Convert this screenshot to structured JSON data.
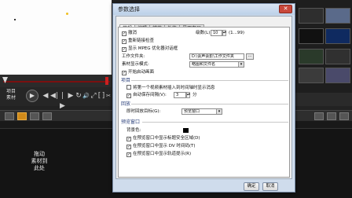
{
  "transport": {
    "project_label": "项目",
    "clip_label": "素材",
    "play_icon": "▶",
    "controls": [
      "◀",
      "◀|",
      "|▶",
      "▶",
      "↻",
      "🔊",
      "⤢",
      "[",
      "]",
      "✂"
    ]
  },
  "timeline": {
    "clip_note": "拖动\n素材到\n此处"
  },
  "dialog": {
    "title": "参数选择",
    "close_label": "✕",
    "tabs": [
      "常规",
      "编辑",
      "捕获",
      "性能",
      "界面布局"
    ],
    "active_tab": "常规",
    "options": {
      "undo_label": "撤消",
      "undo_levels_label": "级数(L):",
      "undo_levels_value": "10",
      "undo_range": "(1...99)",
      "relink_label": "重新链接检查",
      "mpeg_label": "显示 MPEG 优化器对话框",
      "workdir_label": "工作文件夹:",
      "workdir_value": "D:\\会声会影\\工作文件夹",
      "browse_label": "...",
      "media_display_label": "素材显示模式:",
      "media_display_value": "略图和文件名",
      "welcome_label": "开始启动画面"
    },
    "project_section": {
      "title": "项目",
      "insert_first_clip_label": "将第一个视频素材插入到时间轴时显示消息",
      "autosave_label": "自动保存间隔(V):",
      "autosave_value": "3",
      "autosave_unit": "分"
    },
    "playback_section": {
      "title": "回放",
      "target_label": "即时回放目标(G):",
      "target_value": "预览窗口"
    },
    "preview_section": {
      "title": "预览窗口",
      "bg_color_label": "背景色:",
      "bg_color": "#000000",
      "title_safe_label": "在预览窗口中显示标题安全区域(D)",
      "dv_timecode_label": "在预览窗口中显示 DV 时间码(T)",
      "track_hint_label": "在预览窗口中显示轨道提示(R)"
    },
    "ok_label": "确定",
    "cancel_label": "取消"
  },
  "colors": {
    "accent": "#d08a1a",
    "scrub_track": "#7a1010",
    "dialog_frame": "#cfdcec"
  }
}
